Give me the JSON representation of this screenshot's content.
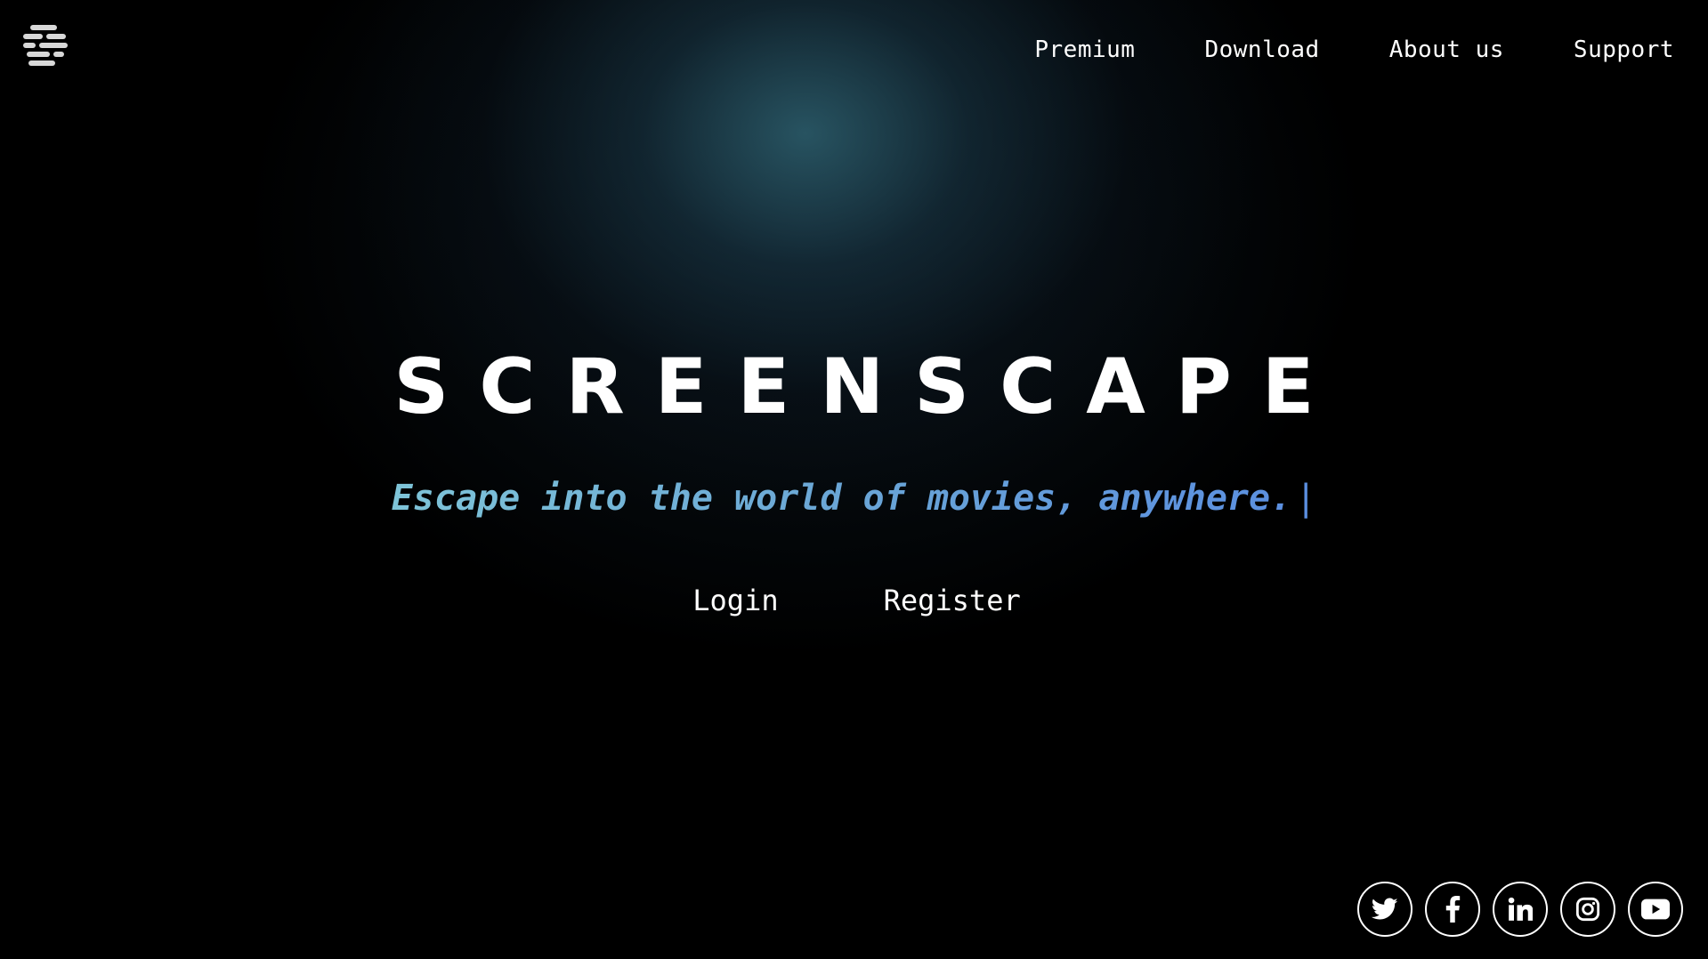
{
  "brand": {
    "title": "SCREENSCAPE",
    "tagline": "Escape into the world of movies, anywhere.",
    "cursor": "|",
    "logo_icon": "logo-icon"
  },
  "nav": {
    "items": [
      {
        "label": "Premium"
      },
      {
        "label": "Download"
      },
      {
        "label": "About us"
      },
      {
        "label": "Support"
      }
    ]
  },
  "auth": {
    "login_label": "Login",
    "register_label": "Register"
  },
  "social": {
    "icons": [
      "twitter-icon",
      "facebook-icon",
      "linkedin-icon",
      "instagram-icon",
      "youtube-icon"
    ]
  },
  "colors": {
    "background": "#000000",
    "glow": "#2d5f6e",
    "tagline_start": "#7ec4d8",
    "tagline_end": "#5b8fe0",
    "text": "#ffffff"
  }
}
